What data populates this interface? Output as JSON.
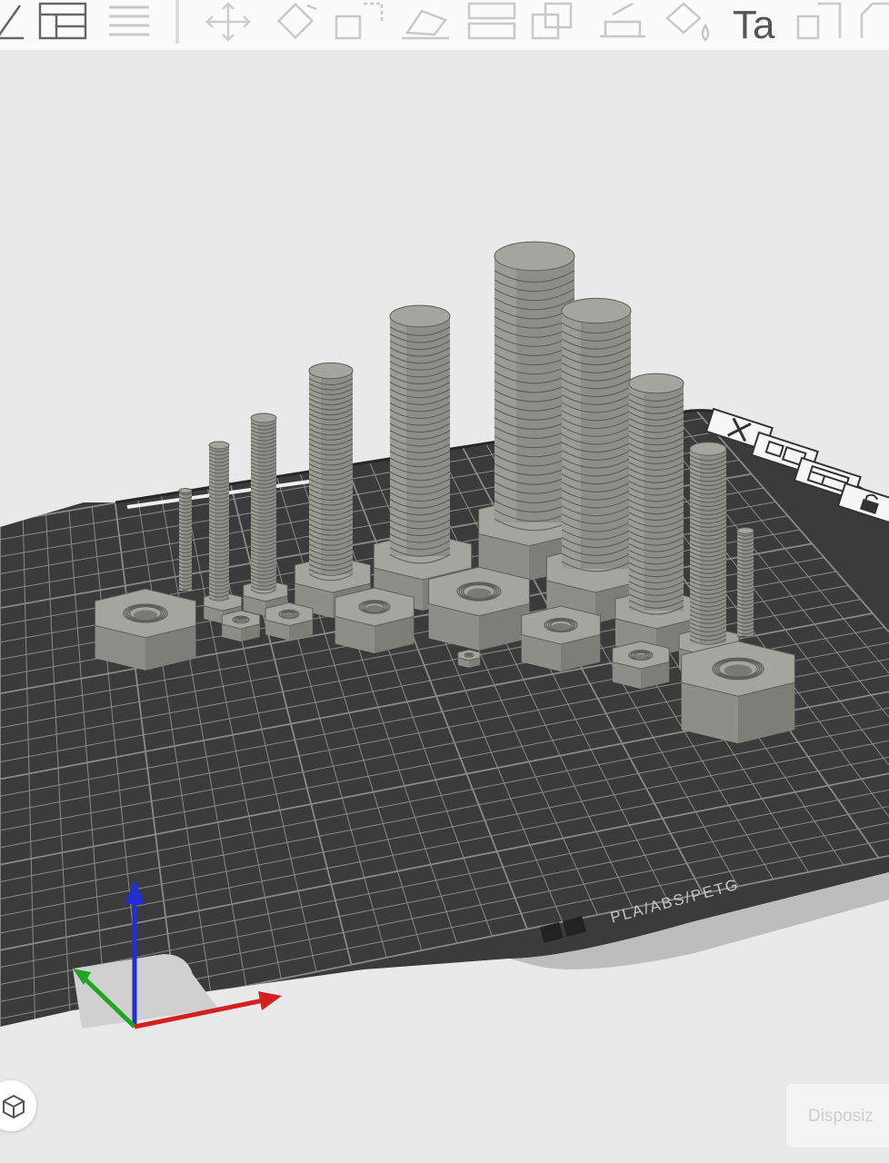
{
  "toolbar": {
    "items": [
      {
        "id": "plate-view",
        "icon": "plate-edit-icon"
      },
      {
        "id": "layout",
        "icon": "layout-grid-icon"
      },
      {
        "id": "menu",
        "icon": "list-icon"
      },
      {
        "id": "move",
        "icon": "move-icon"
      },
      {
        "id": "rotate",
        "icon": "rotate-icon"
      },
      {
        "id": "scale",
        "icon": "scale-icon"
      },
      {
        "id": "lay-on-face",
        "icon": "place-on-face-icon"
      },
      {
        "id": "cut",
        "icon": "cut-icon"
      },
      {
        "id": "boolean",
        "icon": "mesh-boolean-icon"
      },
      {
        "id": "support-paint",
        "icon": "support-paint-icon"
      },
      {
        "id": "color-paint",
        "icon": "color-paint-icon"
      },
      {
        "id": "text",
        "icon": "text-emboss-icon",
        "label": "Ta"
      },
      {
        "id": "seam",
        "icon": "seam-paint-icon"
      },
      {
        "id": "more",
        "icon": "more-icon"
      }
    ]
  },
  "build_plate": {
    "label": "PLA/ABS/PETG",
    "colors": {
      "plate": "#3b3b3b",
      "grid": "#8c8c8c",
      "object": "#8e8e88",
      "background": "#e9e9e9"
    }
  },
  "axes": {
    "x_color": "#d42020",
    "y_color": "#1fa51f",
    "z_color": "#1f2fd0"
  },
  "view_cube": {
    "icon": "view-cube-icon"
  },
  "arrange": {
    "label": "Disposiz"
  }
}
